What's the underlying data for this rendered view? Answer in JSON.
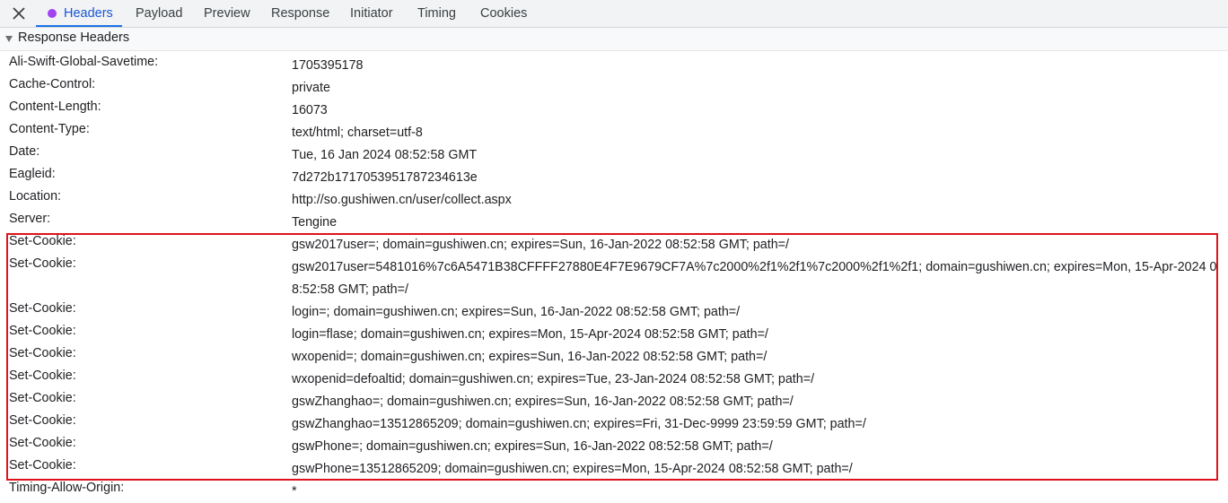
{
  "tabs": [
    {
      "label": "Headers",
      "active": true
    },
    {
      "label": "Payload",
      "active": false
    },
    {
      "label": "Preview",
      "active": false
    },
    {
      "label": "Response",
      "active": false
    },
    {
      "label": "Initiator",
      "active": false
    },
    {
      "label": "Timing",
      "active": false
    },
    {
      "label": "Cookies",
      "active": false
    }
  ],
  "section": {
    "title": "Response Headers"
  },
  "headers": [
    {
      "name": "Ali-Swift-Global-Savetime:",
      "value": "1705395178"
    },
    {
      "name": "Cache-Control:",
      "value": "private"
    },
    {
      "name": "Content-Length:",
      "value": "16073"
    },
    {
      "name": "Content-Type:",
      "value": "text/html; charset=utf-8"
    },
    {
      "name": "Date:",
      "value": "Tue, 16 Jan 2024 08:52:58 GMT"
    },
    {
      "name": "Eagleid:",
      "value": "7d272b1717053951787234613e"
    },
    {
      "name": "Location:",
      "value": "http://so.gushiwen.cn/user/collect.aspx"
    },
    {
      "name": "Server:",
      "value": "Tengine"
    },
    {
      "name": "Set-Cookie:",
      "value": "gsw2017user=; domain=gushiwen.cn; expires=Sun, 16-Jan-2022 08:52:58 GMT; path=/"
    },
    {
      "name": "Set-Cookie:",
      "value": "gsw2017user=5481016%7c6A5471B38CFFFF27880E4F7E9679CF7A%7c2000%2f1%2f1%7c2000%2f1%2f1; domain=gushiwen.cn; expires=Mon, 15-Apr-2024 08:52:58 GMT; path=/"
    },
    {
      "name": "Set-Cookie:",
      "value": "login=; domain=gushiwen.cn; expires=Sun, 16-Jan-2022 08:52:58 GMT; path=/"
    },
    {
      "name": "Set-Cookie:",
      "value": "login=flase; domain=gushiwen.cn; expires=Mon, 15-Apr-2024 08:52:58 GMT; path=/"
    },
    {
      "name": "Set-Cookie:",
      "value": "wxopenid=; domain=gushiwen.cn; expires=Sun, 16-Jan-2022 08:52:58 GMT; path=/"
    },
    {
      "name": "Set-Cookie:",
      "value": "wxopenid=defoaltid; domain=gushiwen.cn; expires=Tue, 23-Jan-2024 08:52:58 GMT; path=/"
    },
    {
      "name": "Set-Cookie:",
      "value": "gswZhanghao=; domain=gushiwen.cn; expires=Sun, 16-Jan-2022 08:52:58 GMT; path=/"
    },
    {
      "name": "Set-Cookie:",
      "value": "gswZhanghao=13512865209; domain=gushiwen.cn; expires=Fri, 31-Dec-9999 23:59:59 GMT; path=/"
    },
    {
      "name": "Set-Cookie:",
      "value": "gswPhone=; domain=gushiwen.cn; expires=Sun, 16-Jan-2022 08:52:58 GMT; path=/"
    },
    {
      "name": "Set-Cookie:",
      "value": "gswPhone=13512865209; domain=gushiwen.cn; expires=Mon, 15-Apr-2024 08:52:58 GMT; path=/"
    },
    {
      "name": "Timing-Allow-Origin:",
      "value": "*"
    }
  ],
  "colors": {
    "active_tab": "#1a56d6",
    "tab_dot": "#a142f4",
    "highlight_border": "#e0121b"
  }
}
